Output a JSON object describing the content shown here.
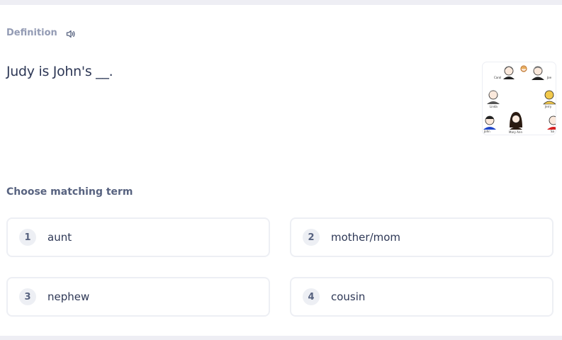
{
  "question": {
    "section_label": "Definition",
    "speaker_icon": "speaker-icon",
    "prompt": "Judy is John's __.",
    "image": {
      "name_labels": [
        "Carol",
        "Joe",
        "Linda",
        "Jerry",
        "John",
        "Mary Ann",
        "Sa"
      ]
    }
  },
  "answers": {
    "section_label": "Choose matching term",
    "options": [
      {
        "number": "1",
        "text": "aunt"
      },
      {
        "number": "2",
        "text": "mother/mom"
      },
      {
        "number": "3",
        "text": "nephew"
      },
      {
        "number": "4",
        "text": "cousin"
      }
    ]
  },
  "colors": {
    "page_background": "#eeeef4",
    "card_background": "#ffffff",
    "primary_text": "#2e3856",
    "secondary_text": "#586380",
    "muted_text": "#939bb4",
    "option_border": "#edeff4"
  }
}
